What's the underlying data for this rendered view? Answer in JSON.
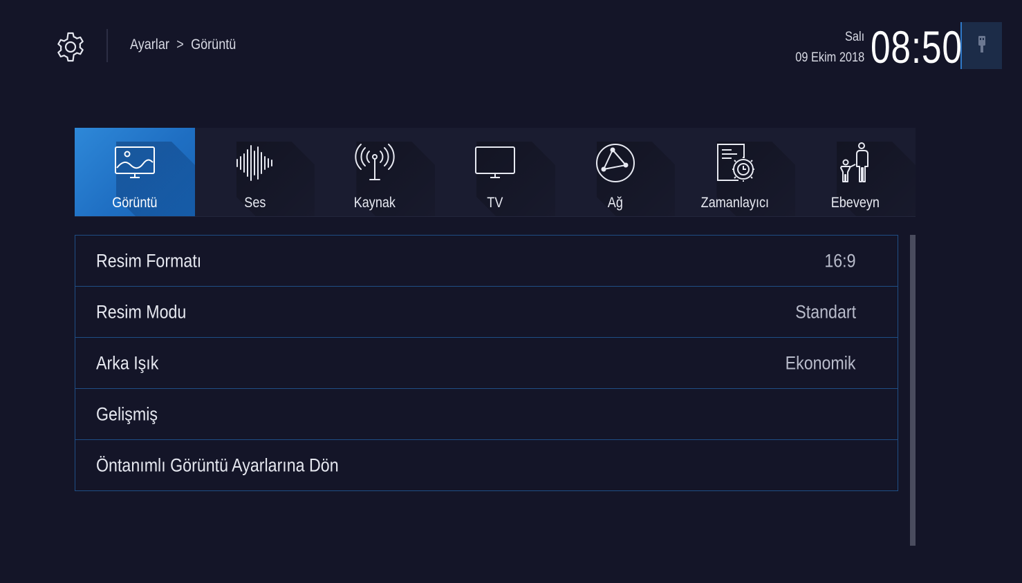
{
  "header": {
    "breadcrumb": [
      "Ayarlar",
      "Görüntü"
    ],
    "breadcrumb_separator": ">",
    "day": "Salı",
    "date": "09 Ekim 2018",
    "time": "08:50",
    "icons": {
      "settings": "gear-icon",
      "device": "usb-icon"
    }
  },
  "tabs": [
    {
      "label": "Görüntü",
      "icon": "picture-icon",
      "active": true
    },
    {
      "label": "Ses",
      "icon": "sound-wave-icon",
      "active": false
    },
    {
      "label": "Kaynak",
      "icon": "antenna-icon",
      "active": false
    },
    {
      "label": "TV",
      "icon": "tv-icon",
      "active": false
    },
    {
      "label": "Ağ",
      "icon": "network-icon",
      "active": false
    },
    {
      "label": "Zamanlayıcı",
      "icon": "timer-icon",
      "active": false
    },
    {
      "label": "Ebeveyn",
      "icon": "parental-icon",
      "active": false
    }
  ],
  "settings": [
    {
      "label": "Resim Formatı",
      "value": "16:9"
    },
    {
      "label": "Resim Modu",
      "value": "Standart"
    },
    {
      "label": "Arka Işık",
      "value": "Ekonomik"
    },
    {
      "label": "Gelişmiş",
      "value": ""
    },
    {
      "label": "Öntanımlı Görüntü Ayarlarına Dön",
      "value": ""
    }
  ],
  "colors": {
    "background": "#141528",
    "active_tab": "#2e88d8",
    "row_border": "#1f4e86",
    "text": "#e6e8f0"
  }
}
